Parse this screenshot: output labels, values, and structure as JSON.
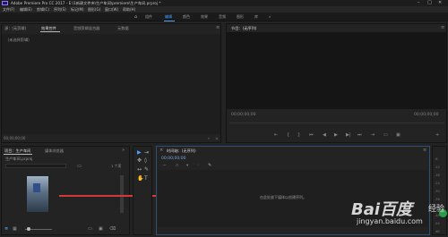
{
  "window": {
    "title": "Adobe Premiere Pro CC 2017 - E:\\1新建文件夹\\生产车间\\premiere\\生产车间.prproj *"
  },
  "menubar": {
    "items": [
      "文件(F)",
      "编辑(E)",
      "剪辑(C)",
      "序列(S)",
      "标记(M)",
      "图形(G)",
      "窗口(W)",
      "帮助(H)"
    ]
  },
  "workspaces": {
    "tabs": [
      "组件",
      "编辑",
      "颜色",
      "效果",
      "音频",
      "图形",
      "库"
    ],
    "active_index": 1,
    "more": "»"
  },
  "source_panel": {
    "tabs": [
      "源：(无剪辑)",
      "效果控件",
      "音频剪辑混合器",
      "元数据"
    ],
    "active_index": 1,
    "message": "（未选择剪辑）",
    "timecode": "00;00;00;00"
  },
  "program_panel": {
    "tab": "节目：(无序列)",
    "timecode_left": "00;00;00;00",
    "timecode_right": "00;00;00;00",
    "controls": [
      "⇤",
      "{",
      "}",
      "⏮",
      "◀",
      "▶",
      "▶|",
      "⏭",
      "⇥",
      "▭",
      "▣",
      "+"
    ]
  },
  "project_panel": {
    "tabs": [
      "项目：生产车间",
      "媒体浏览器"
    ],
    "active_index": 0,
    "search_placeholder": "",
    "project_file": "生产车间.prproj",
    "item_count": "1 个项",
    "clip_duration": ""
  },
  "tools": {
    "items": [
      "▶",
      "⇥",
      "✥",
      "◊",
      "↔",
      "✎",
      "✋",
      "T"
    ],
    "active_index": 0
  },
  "timeline_panel": {
    "tab": "时间轴：(无序列)",
    "timecode": "00;00;00;00",
    "empty_message": "在此处放下媒体以创建序列。"
  },
  "audio_meter": {
    "labels": [
      "-6",
      "-12",
      "-18",
      "-24",
      "-30",
      "-36",
      "-42",
      "-48",
      "-54"
    ],
    "unit": "dB"
  },
  "watermark": {
    "brand": "Bai百度",
    "sub": "经验",
    "url": "jingyan.baidu.com"
  },
  "colors": {
    "accent": "#4aa3ff",
    "arrow": "#d23a3a"
  }
}
